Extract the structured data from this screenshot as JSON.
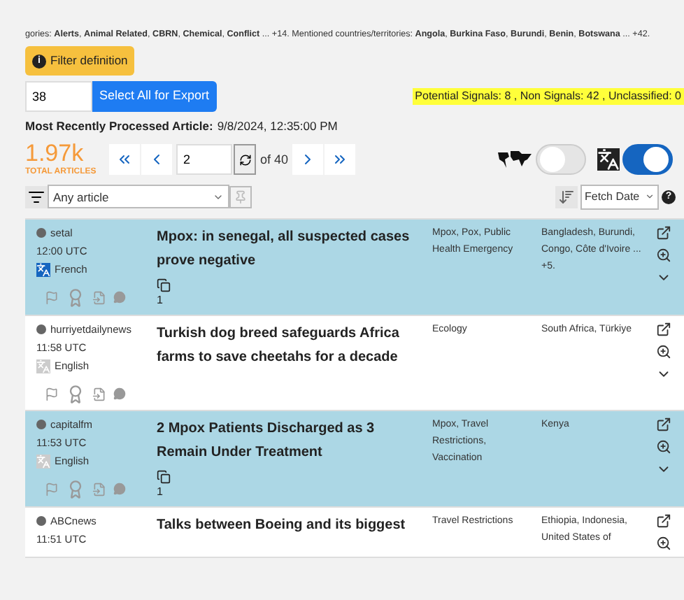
{
  "filter_summary": "gories: **Alerts**, **Animal Related**, **CBRN**, **Chemical**, **Conflict** ... +14. Mentioned countries/territories: **Angola**, **Burkina Faso**, **Burundi**, **Benin**, **Botswana** ... +42.",
  "filter_button": {
    "icon": "i",
    "label": "Filter definition"
  },
  "export": {
    "value": "38",
    "button": "Select All for Export"
  },
  "signals": "Potential Signals: 8 , Non Signals: 42 , Unclassified: 0",
  "recent": {
    "label": "Most Recently Processed Article:",
    "value": "9/8/2024, 12:35:00 PM"
  },
  "total": {
    "value": "1.97k",
    "label": "TOTAL ARTICLES"
  },
  "pager": {
    "page": "2",
    "of": "of 40"
  },
  "map_toggle": {
    "on": false
  },
  "translate_toggle": {
    "on": true
  },
  "article_filter": {
    "value": "Any article"
  },
  "sort": {
    "value": "Fetch Date",
    "help": "?"
  },
  "articles": [
    {
      "source": "setal",
      "time": "12:00 UTC",
      "language": "French",
      "translated": true,
      "selected": true,
      "title": "Mpox: in senegal, all suspected cases prove negative",
      "topics": "Mpox, Pox, Public Health Emergency",
      "countries": "Bangladesh, Burundi, Congo, Côte d'Ivoire ... +5.",
      "duplicates": "1"
    },
    {
      "source": "hurriyetdailynews",
      "time": "11:58 UTC",
      "language": "English",
      "translated": false,
      "selected": false,
      "title": "Turkish dog breed safeguards Africa farms to save cheetahs for a decade",
      "topics": "Ecology",
      "countries": "South Africa, Türkiye"
    },
    {
      "source": "capitalfm",
      "time": "11:53 UTC",
      "language": "English",
      "translated": false,
      "selected": true,
      "title": "2 Mpox Patients Discharged as 3 Remain Under Treatment",
      "topics": "Mpox, Travel Restrictions, Vaccination",
      "countries": "Kenya",
      "duplicates": "1"
    },
    {
      "source": "ABCnews",
      "time": "11:51 UTC",
      "selected": false,
      "title": "Talks between Boeing and its biggest",
      "topics": "Travel Restrictions",
      "countries": "Ethiopia, Indonesia, United States of"
    }
  ]
}
